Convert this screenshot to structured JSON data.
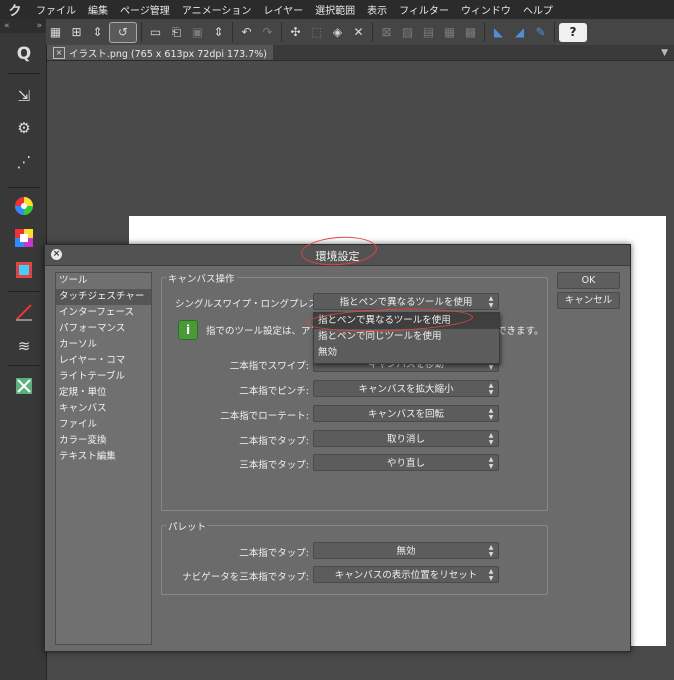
{
  "app": {
    "logo": "ク",
    "menus": [
      "ファイル",
      "編集",
      "ページ管理",
      "アニメーション",
      "レイヤー",
      "選択範囲",
      "表示",
      "フィルター",
      "ウィンドウ",
      "ヘルプ"
    ]
  },
  "toolbar": {
    "icons": [
      "grid-icon",
      "transform-icon",
      "rotate-icon",
      "new-file-icon",
      "open-icon",
      "save-icon",
      "save-as-icon",
      "undo-icon",
      "redo-icon",
      "select-icon",
      "fill-icon",
      "clear-icon",
      "transform2-icon",
      "ruler-icon",
      "ruler2-icon",
      "pen-icon",
      "pen2-icon",
      "ruler3-icon",
      "help-icon"
    ],
    "help_label": "?"
  },
  "document": {
    "tab_title": "イラスト.png (765 x 613px 72dpi 173.7%)",
    "close_label": "×"
  },
  "dialog": {
    "title": "環境設定",
    "close_label": "×",
    "categories": [
      {
        "label": "ツール",
        "selected": false
      },
      {
        "label": "タッチジェスチャー",
        "selected": true
      },
      {
        "label": "インターフェース",
        "selected": false
      },
      {
        "label": "パフォーマンス",
        "selected": false
      },
      {
        "label": "カーソル",
        "selected": false
      },
      {
        "label": "レイヤー・コマ",
        "selected": false
      },
      {
        "label": "ライトテーブル",
        "selected": false
      },
      {
        "label": "定規・単位",
        "selected": false
      },
      {
        "label": "キャンバス",
        "selected": false
      },
      {
        "label": "ファイル",
        "selected": false
      },
      {
        "label": "カラー変換",
        "selected": false
      },
      {
        "label": "テキスト編集",
        "selected": false
      }
    ],
    "ok_label": "OK",
    "cancel_label": "キャンセル",
    "canvas_group": {
      "label": "キャンバス操作",
      "single_swipe_label": "シングルスワイプ・ロングプレス:",
      "single_swipe_value": "指とペンで異なるツールを使用",
      "info_text_left": "指でのツール設定は、アプ",
      "info_text_right": "できます。",
      "rows": [
        {
          "label": "二本指でスワイプ:",
          "value": "キャンバスを移動"
        },
        {
          "label": "二本指でピンチ:",
          "value": "キャンバスを拡大縮小"
        },
        {
          "label": "二本指でローテート:",
          "value": "キャンバスを回転"
        },
        {
          "label": "二本指でタップ:",
          "value": "取り消し"
        },
        {
          "label": "三本指でタップ:",
          "value": "やり直し"
        }
      ]
    },
    "palette_group": {
      "label": "パレット",
      "rows": [
        {
          "label": "二本指でタップ:",
          "value": "無効"
        },
        {
          "label": "ナビゲータを三本指でタップ:",
          "value": "キャンバスの表示位置をリセット"
        }
      ]
    },
    "popup_options": [
      {
        "label": "指とペンで異なるツールを使用",
        "selected": true
      },
      {
        "label": "指とペンで同じツールを使用",
        "selected": false
      },
      {
        "label": "無効",
        "selected": false
      }
    ]
  },
  "colors": {
    "annotation": "#e04545",
    "info_icon": "#4a9a3a"
  }
}
